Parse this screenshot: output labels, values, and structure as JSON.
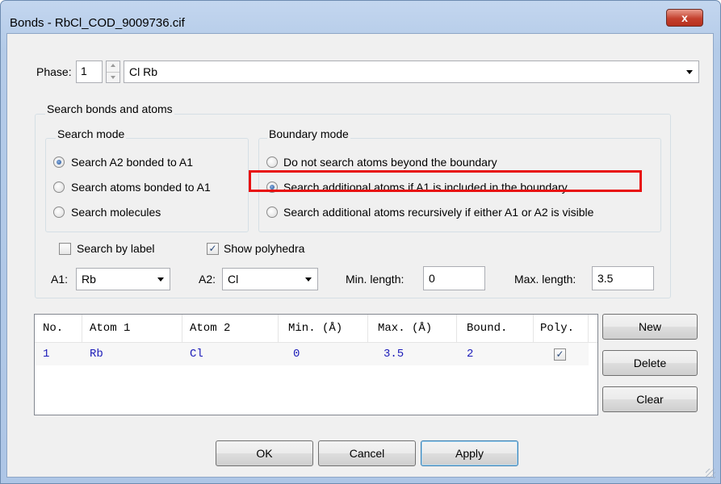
{
  "window": {
    "title": "Bonds - RbCl_COD_9009736.cif",
    "close_glyph": "x"
  },
  "phase": {
    "label": "Phase:",
    "value": "1",
    "combo_value": "Cl Rb"
  },
  "search_group": {
    "title": "Search bonds and atoms",
    "search_mode": {
      "title": "Search mode",
      "options": [
        "Search A2 bonded to A1",
        "Search atoms bonded to A1",
        "Search molecules"
      ],
      "selected": 0
    },
    "boundary_mode": {
      "title": "Boundary mode",
      "options": [
        "Do not search atoms beyond the boundary",
        "Search additional atoms if A1 is included in the boundary",
        "Search additional atoms recursively if either A1 or A2 is visible"
      ],
      "selected": 1
    },
    "search_by_label": {
      "label": "Search by label",
      "checked": false
    },
    "show_polyhedra": {
      "label": "Show polyhedra",
      "checked": true
    },
    "a1": {
      "label": "A1:",
      "value": "Rb"
    },
    "a2": {
      "label": "A2:",
      "value": "Cl"
    },
    "min_length": {
      "label": "Min. length:",
      "value": "0"
    },
    "max_length": {
      "label": "Max. length:",
      "value": "3.5"
    }
  },
  "table": {
    "columns": [
      "No.",
      "Atom 1",
      "Atom 2",
      "Min. (Å)",
      "Max. (Å)",
      "Bound.",
      "Poly."
    ],
    "rows": [
      {
        "no": "1",
        "atom1": "Rb",
        "atom2": "Cl",
        "min": "0",
        "max": "3.5",
        "bound": "2",
        "poly": true
      }
    ]
  },
  "side_buttons": {
    "new": "New",
    "delete": "Delete",
    "clear": "Clear"
  },
  "footer": {
    "ok": "OK",
    "cancel": "Cancel",
    "apply": "Apply"
  },
  "colors": {
    "highlight": "#e81010",
    "table_text": "#1a1ab8",
    "title_bar": "#b4cbe8"
  }
}
